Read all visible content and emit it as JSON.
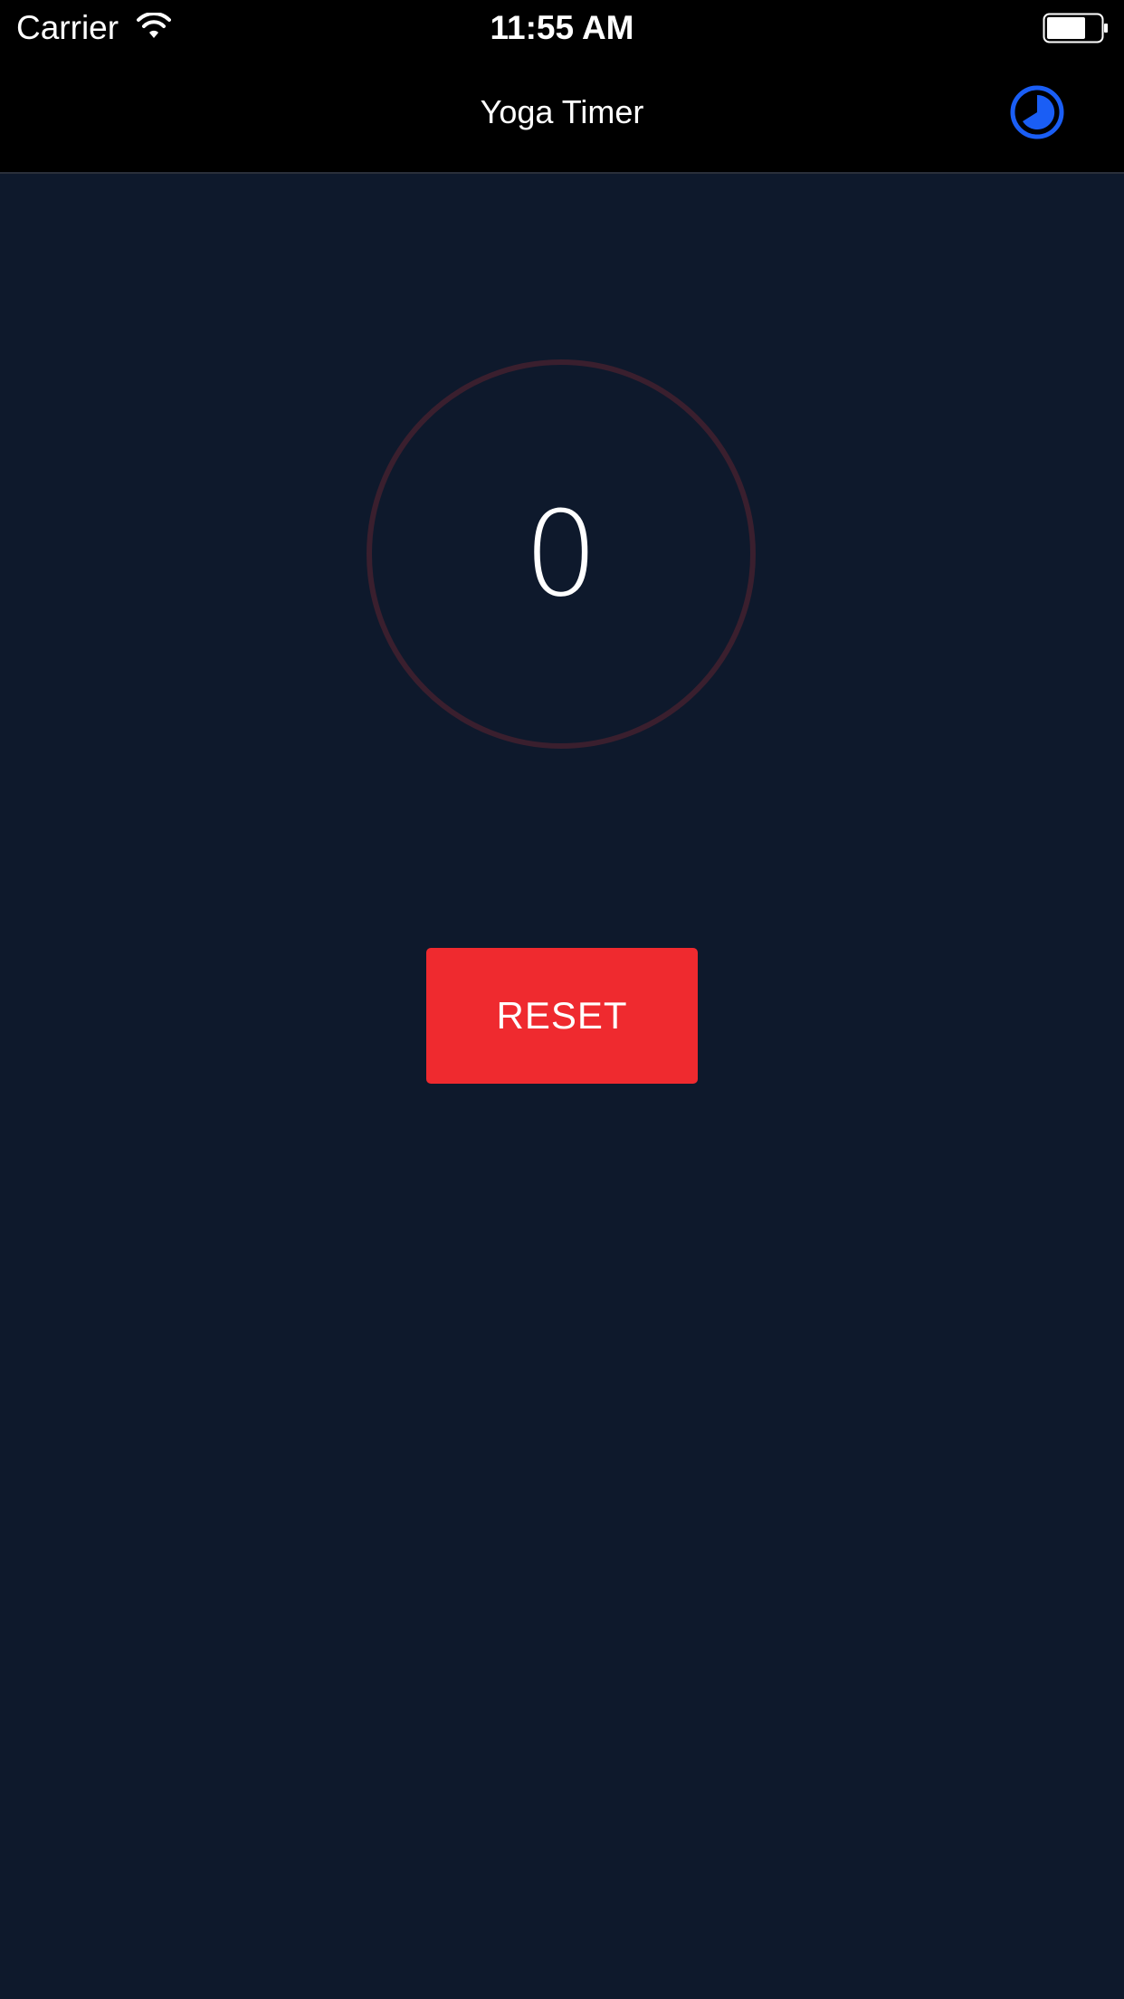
{
  "status_bar": {
    "carrier": "Carrier",
    "time": "11:55 AM",
    "wifi_icon": "wifi-icon",
    "battery_icon": "battery-icon"
  },
  "nav_bar": {
    "title": "Yoga Timer",
    "history_icon": "history-clock-icon",
    "accent_color": "#1a5ef5"
  },
  "timer": {
    "value": "0",
    "ring_color": "#3a1f2e"
  },
  "actions": {
    "reset_label": "RESET",
    "reset_color": "#ef2a2f"
  },
  "colors": {
    "background": "#0e192c",
    "bars": "#000000"
  }
}
